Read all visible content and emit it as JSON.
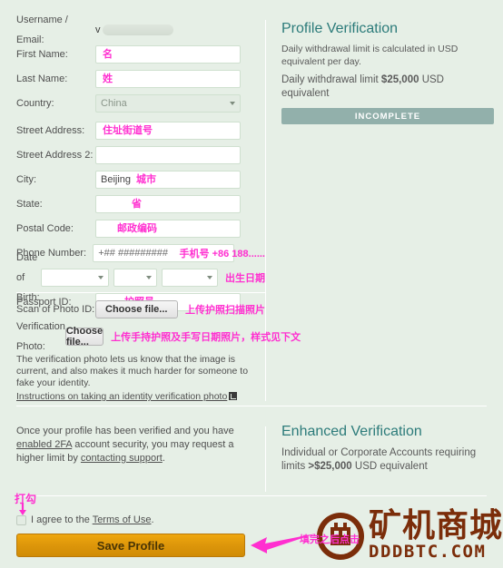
{
  "form": {
    "username_label": "Username / Email:",
    "username_value_visible": "v",
    "fields": [
      {
        "label": "First Name:",
        "value": "",
        "annotation_inside": "名",
        "type": "text"
      },
      {
        "label": "Last Name:",
        "value": "",
        "annotation_inside": "姓",
        "type": "text"
      },
      {
        "label": "Country:",
        "value": "China",
        "annotation_inside": "",
        "type": "select"
      },
      {
        "label": "Street Address:",
        "value": "",
        "annotation_inside": "住址街道号",
        "type": "text"
      },
      {
        "label": "Street Address 2:",
        "value": "",
        "annotation_inside": "",
        "type": "text"
      },
      {
        "label": "City:",
        "value": "Beijing",
        "annotation_inside": "城市",
        "type": "text"
      },
      {
        "label": "State:",
        "value": "",
        "annotation_inside": "省",
        "type": "text"
      },
      {
        "label": "Postal Code:",
        "value": "",
        "annotation_inside": "邮政编码",
        "type": "text"
      },
      {
        "label": "Phone Number:",
        "value": "+## #########",
        "annotation_inside": "",
        "type": "text"
      },
      {
        "label": "Date of Birth:",
        "value": "",
        "annotation_inside": "",
        "type": "dob"
      },
      {
        "label": "Passport ID:",
        "value": "",
        "annotation_inside": "护照号",
        "type": "text"
      }
    ],
    "phone_annotation": "手机号 +86 188......",
    "dob_annotation": "出生日期",
    "scan_label": "Scan of Photo ID:",
    "scan_button": "Choose file...",
    "scan_annotation": "上传护照扫描照片",
    "verify_label": "Verification Photo:",
    "verify_button": "Choose file...",
    "verify_annotation": "上传手持护照及手写日期照片，样式见下文",
    "verify_paragraph": "The verification photo lets us know that the image is current, and also makes it much harder for someone to fake your identity.",
    "instructions_link": "Instructions on taking an identity verification photo"
  },
  "profile_verification": {
    "title": "Profile Verification",
    "description": "Daily withdrawal limit is calculated in USD equivalent per day.",
    "limit_prefix": "Daily withdrawal limit ",
    "limit_amount": "$25,000",
    "limit_suffix": " USD equivalent",
    "status_badge": "INCOMPLETE",
    "badge_color": "#92b0ab",
    "title_color": "#2c7b7a"
  },
  "enhanced_verification": {
    "title": "Enhanced Verification",
    "line1": "Individual or Corporate Accounts requiring",
    "line2_prefix": "limits ",
    "line2_amount": ">$25,000",
    "line2_suffix": " USD equivalent"
  },
  "bottom": {
    "paragraph_a": "Once your profile has been verified and you have",
    "link_2fa": "enabled 2FA",
    "paragraph_b": " account security, you may request a",
    "paragraph_c": "higher limit by ",
    "link_support": "contacting support",
    "paragraph_d": ".",
    "agree_prefix": "I agree to the ",
    "terms_link": "Terms of Use",
    "agree_suffix": ".",
    "save_button": "Save Profile",
    "checkbox_annotation": "打勾",
    "save_annotation": "填完之后点击"
  },
  "watermark": {
    "chinese": "矿机商城",
    "domain": "DDDBTC.COM",
    "color": "#7b2d0a"
  },
  "theme": {
    "background": "#e6efe6",
    "accent_pink": "#ff2fd0",
    "save_orange": "#dd960a",
    "teal": "#2c7b7a"
  }
}
